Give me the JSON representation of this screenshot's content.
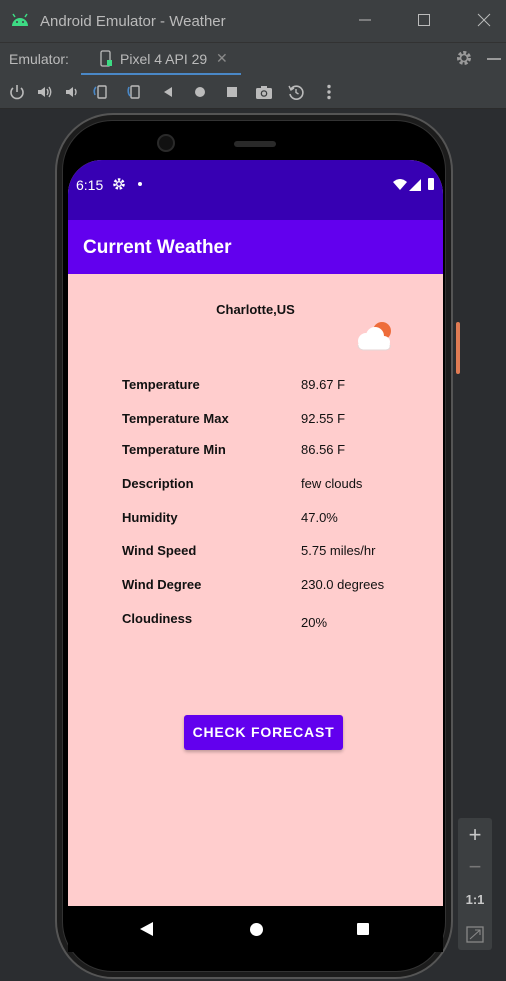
{
  "window": {
    "title": "Android Emulator - Weather",
    "icon": "android-logo-icon"
  },
  "tabbar": {
    "emulator_label": "Emulator:",
    "device_tab": "Pixel 4 API 29",
    "close_glyph": "✕"
  },
  "toolbar": {
    "icons": [
      "power-icon",
      "volume-up-icon",
      "volume-down-icon",
      "rotate-left-icon",
      "rotate-right-icon",
      "back-icon",
      "home-icon",
      "overview-icon",
      "screenshot-icon",
      "snapshot-icon",
      "more-icon"
    ]
  },
  "phone": {
    "status_time": "6:15",
    "app_title": "Current Weather",
    "city": "Charlotte,US",
    "weather_rows": [
      {
        "label": "Temperature",
        "value": "89.67 F"
      },
      {
        "label": "Temperature Max",
        "value": "92.55 F"
      },
      {
        "label": "Temperature Min",
        "value": "86.56 F"
      },
      {
        "label": "Description",
        "value": "few clouds"
      },
      {
        "label": "Humidity",
        "value": "47.0%"
      },
      {
        "label": "Wind Speed",
        "value": "5.75 miles/hr"
      },
      {
        "label": "Wind Degree",
        "value": "230.0 degrees"
      },
      {
        "label": "Cloudiness",
        "value": "20%"
      }
    ],
    "forecast_button": "CHECK FORECAST"
  },
  "zoom": {
    "plus": "+",
    "minus": "−",
    "ratio": "1:1"
  },
  "colors": {
    "status_bar": "#3700b3",
    "app_bar": "#6200ee",
    "content_bg": "#ffcdcd",
    "sun": "#ee6c3a"
  }
}
